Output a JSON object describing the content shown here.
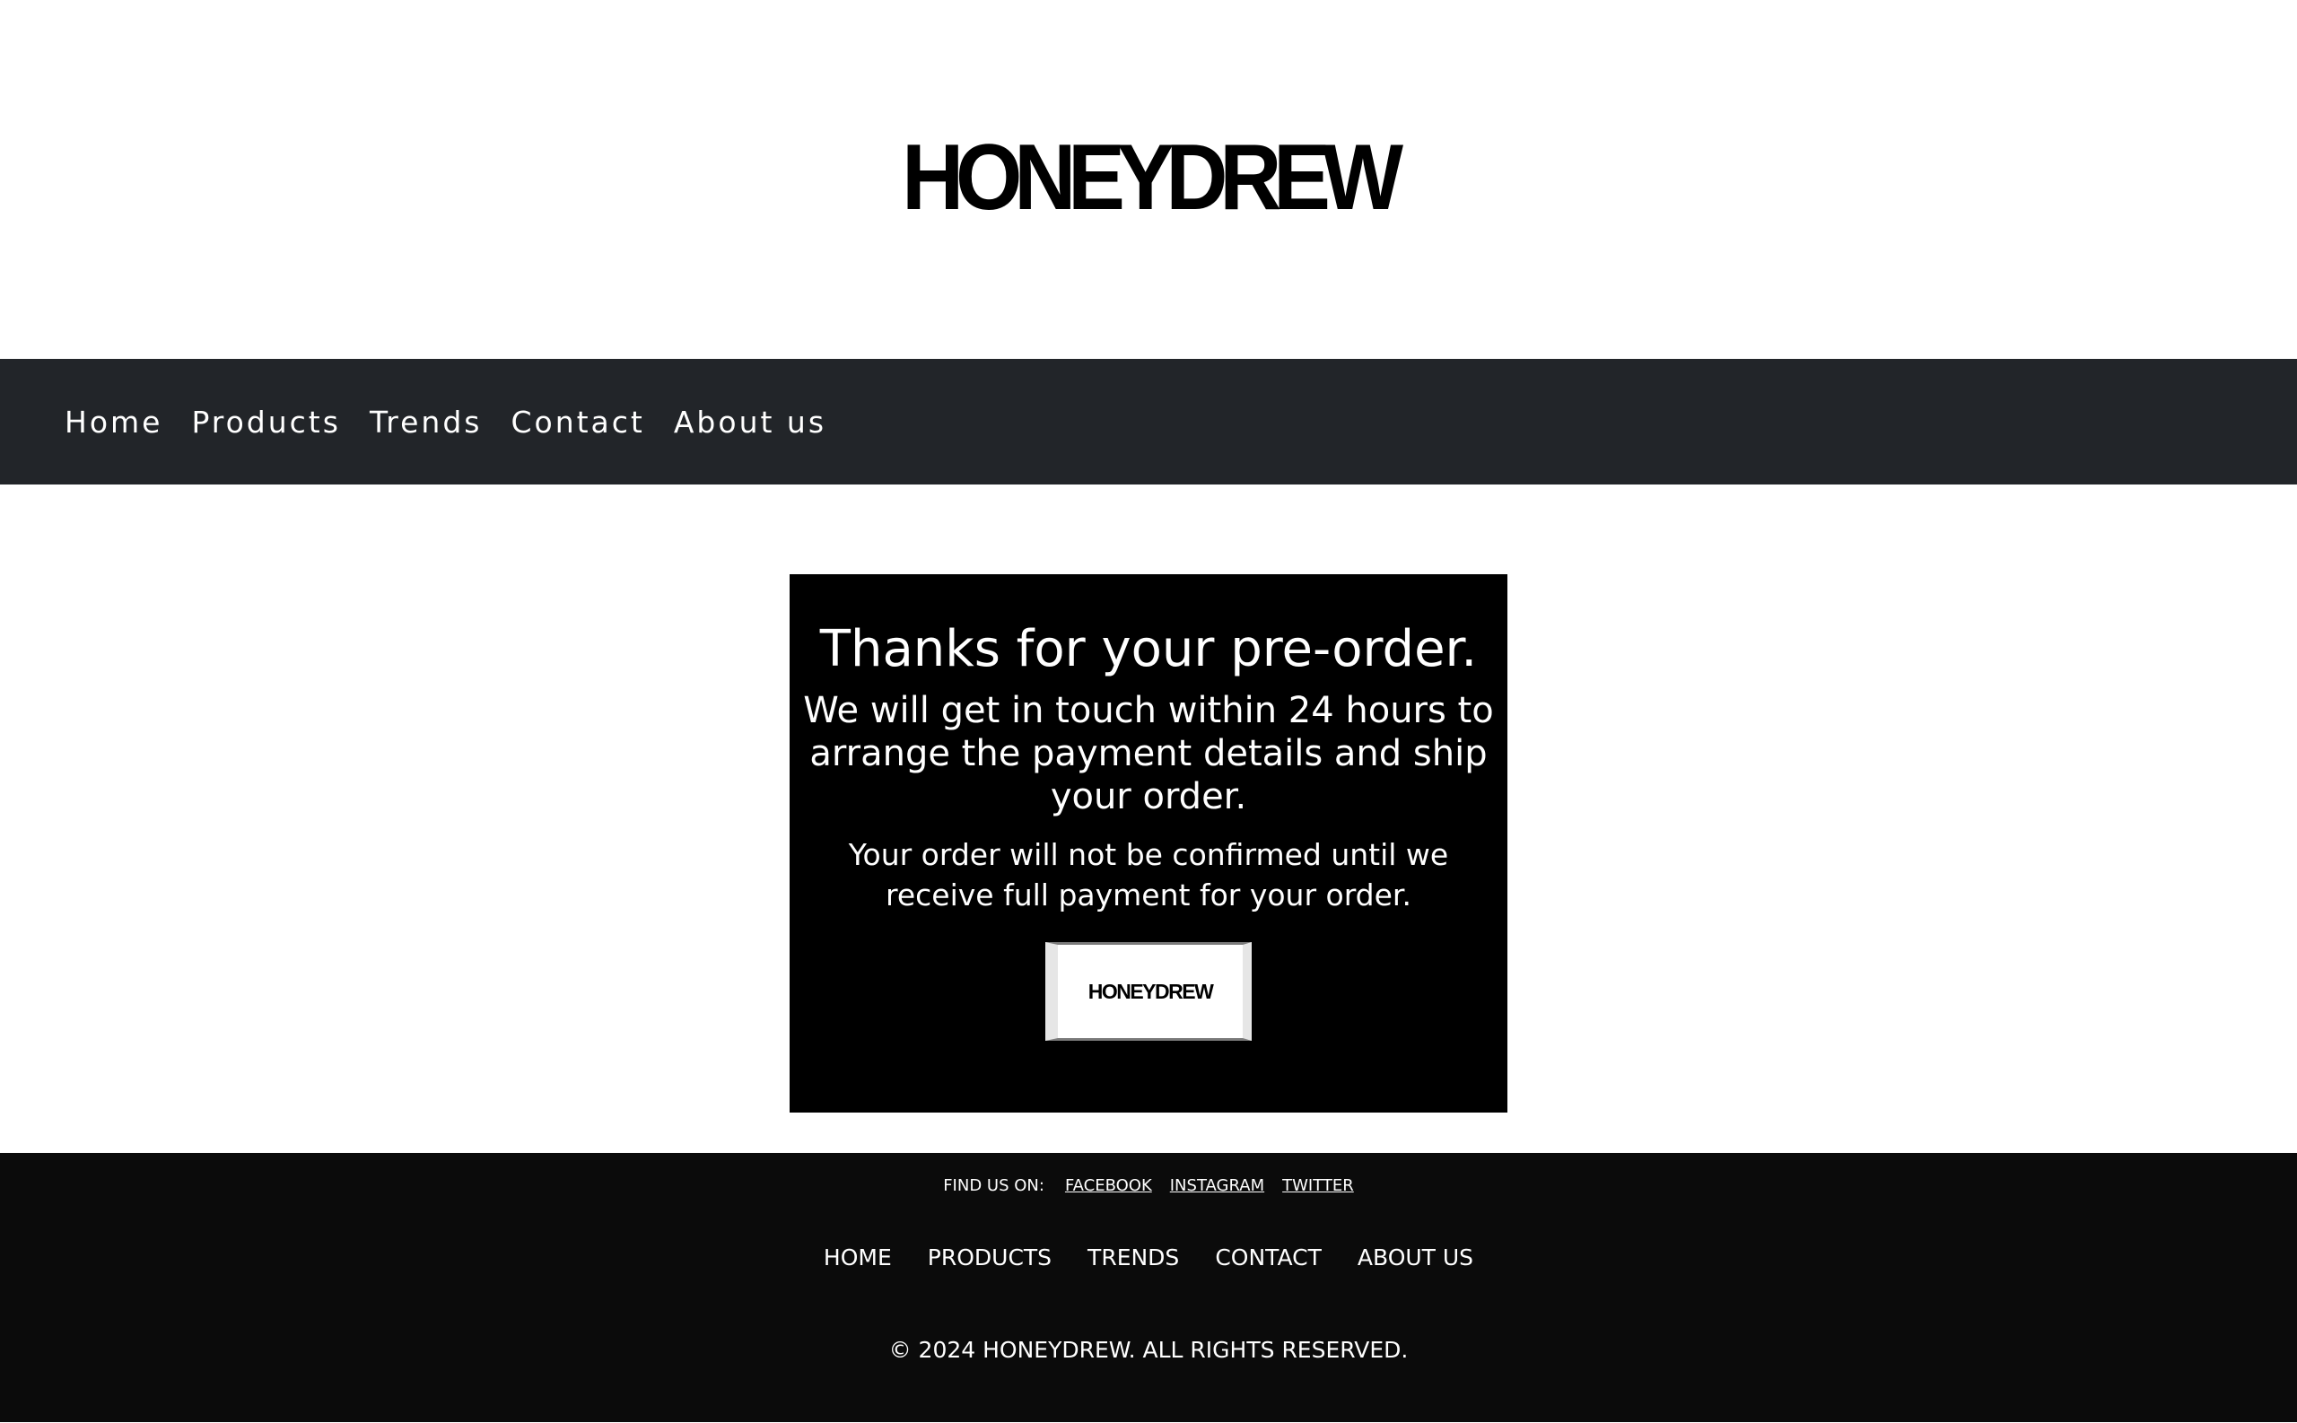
{
  "header": {
    "logo_text": "HONEYDREW"
  },
  "nav": {
    "items": [
      {
        "label": "Home"
      },
      {
        "label": "Products"
      },
      {
        "label": "Trends"
      },
      {
        "label": "Contact"
      },
      {
        "label": "About us"
      }
    ]
  },
  "confirmation": {
    "title": "Thanks for your pre-order.",
    "subtitle": "We will get in touch within 24 hours to arrange the payment details and ship your order.",
    "note": "Your order will not be confirmed until we receive full payment for your order.",
    "logo_button_text": "HONEYDREW"
  },
  "footer": {
    "find_us_label": "FIND US ON:",
    "social_links": [
      {
        "label": "FACEBOOK"
      },
      {
        "label": "INSTAGRAM"
      },
      {
        "label": "TWITTER"
      }
    ],
    "nav_items": [
      {
        "label": "HOME"
      },
      {
        "label": "PRODUCTS"
      },
      {
        "label": "TRENDS"
      },
      {
        "label": "CONTACT"
      },
      {
        "label": "ABOUT US"
      }
    ],
    "copyright": "© 2024 HONEYDREW. ALL RIGHTS RESERVED."
  }
}
